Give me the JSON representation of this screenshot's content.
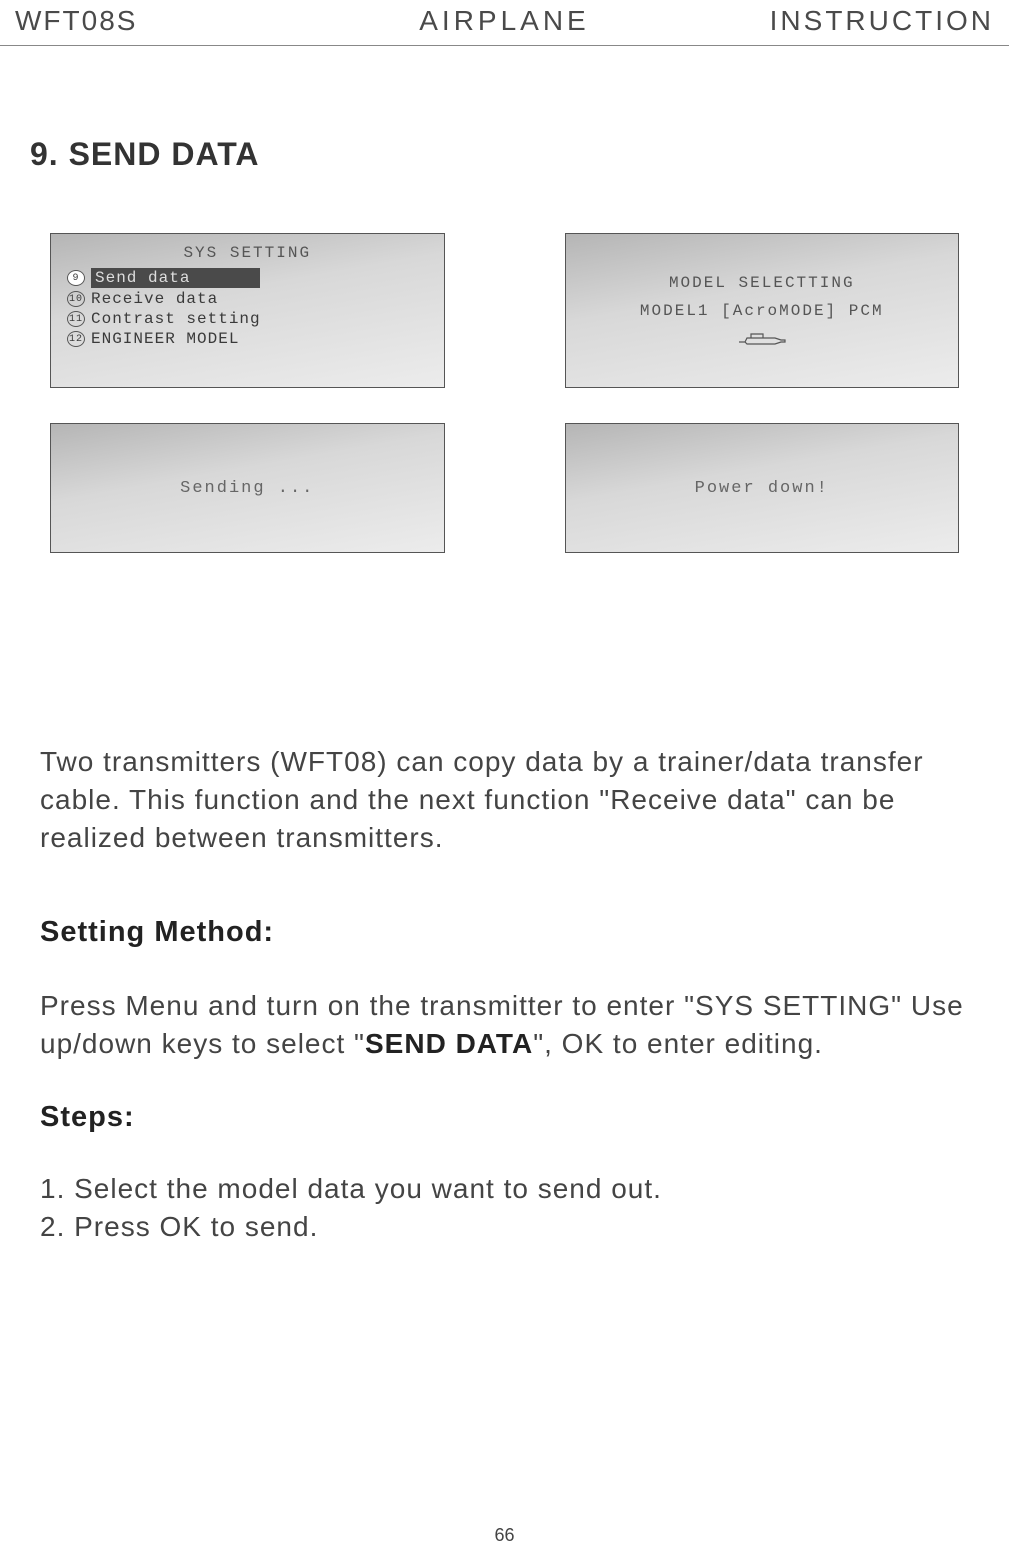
{
  "header": {
    "left": "WFT08S",
    "center": "AIRPLANE",
    "right": "INSTRUCTION"
  },
  "section_title": "9. SEND DATA",
  "screens": {
    "sys": {
      "title": "SYS SETTING",
      "items": [
        {
          "num": "9",
          "label": "Send data",
          "selected": true
        },
        {
          "num": "10",
          "label": "Receive data",
          "selected": false
        },
        {
          "num": "11",
          "label": "Contrast setting",
          "selected": false
        },
        {
          "num": "12",
          "label": "ENGINEER MODEL",
          "selected": false
        }
      ]
    },
    "model": {
      "title": "MODEL SELECTTING",
      "line": "MODEL1 [AcroMODE] PCM"
    },
    "sending": "Sending ...",
    "power": "Power down!"
  },
  "intro": "Two transmitters (WFT08) can copy data by a trainer/data transfer cable. This function and the  next function \"Receive data\" can be realized between transmitters.",
  "setting_heading": "Setting Method:",
  "setting_text_pre": "Press Menu and turn on the transmitter to enter \"SYS SETTING\" Use up/down keys to select \"",
  "setting_text_bold": "SEND DATA",
  "setting_text_post": "\", OK to enter editing.",
  "steps_heading": "Steps:",
  "steps": [
    "1. Select the model data you want to send out.",
    "2. Press OK to send."
  ],
  "page_number": "66"
}
